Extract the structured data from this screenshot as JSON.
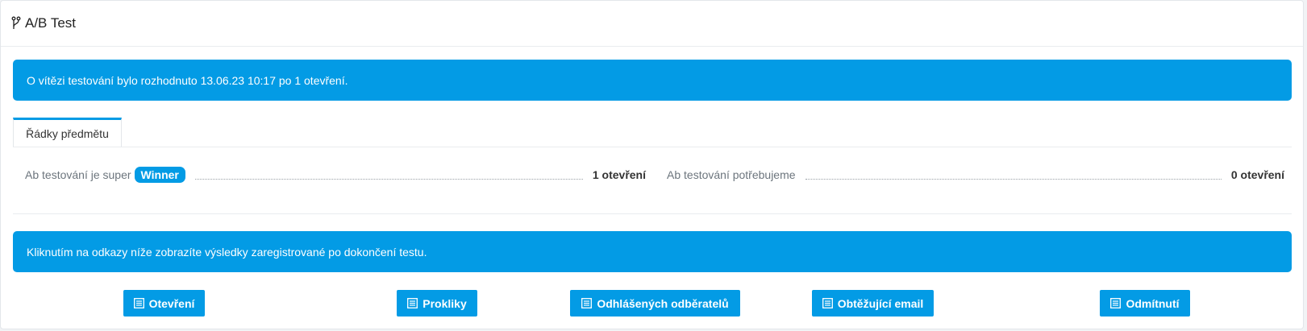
{
  "header": {
    "title": "A/B Test",
    "icon": "branch-icon"
  },
  "alerts": {
    "winner_info": "O vítězi testování bylo rozhodnuto 13.06.23 10:17 po 1 otevření.",
    "results_info": "Kliknutím na odkazy níže zobrazíte výsledky zaregistrované po dokončení testu."
  },
  "tabs": [
    {
      "label": "Řádky předmětu",
      "active": true
    }
  ],
  "subject_lines": [
    {
      "label": "Ab testování je super",
      "badge": "Winner",
      "count": "1 otevření"
    },
    {
      "label": "Ab testování potřebujeme",
      "badge": "",
      "count": "0 otevření"
    }
  ],
  "buttons": [
    {
      "label": "Otevření",
      "icon": "list-icon"
    },
    {
      "label": "Prokliky",
      "icon": "list-icon"
    },
    {
      "label": "Odhlášených odběratelů",
      "icon": "list-icon"
    },
    {
      "label": "Obtěžující email",
      "icon": "list-icon"
    },
    {
      "label": "Odmítnutí",
      "icon": "list-icon"
    }
  ],
  "colors": {
    "accent": "#039be5",
    "card": "#ffffff",
    "background": "#f1f3f5"
  }
}
